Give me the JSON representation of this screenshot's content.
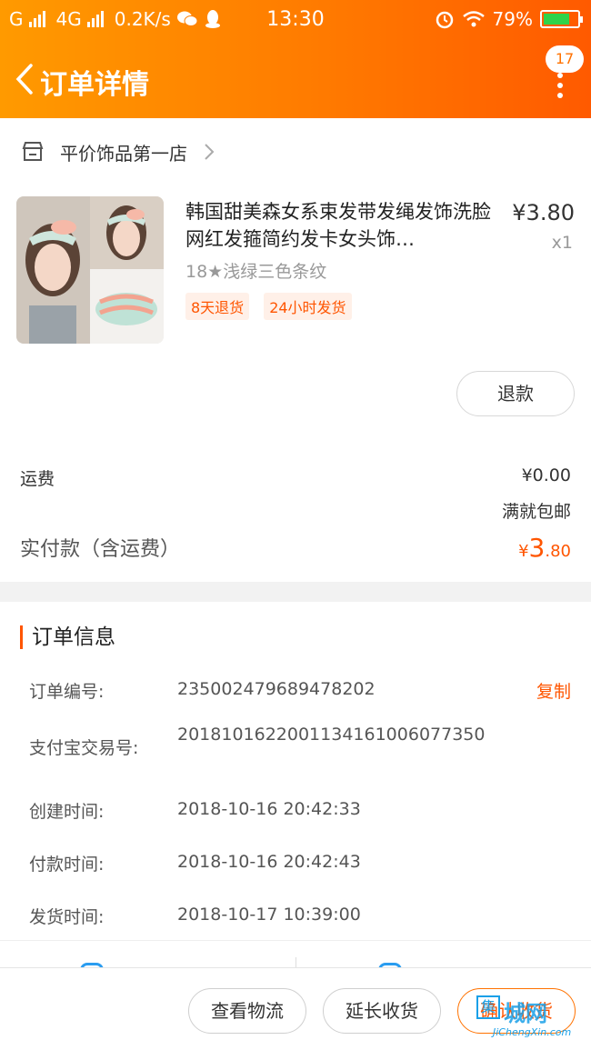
{
  "status_bar": {
    "carrier": "G",
    "network": "4G",
    "speed": "0.2K/s",
    "time": "13:30",
    "battery": "79%",
    "battery_level": 0.79
  },
  "header": {
    "title": "订单详情",
    "badge_count": "17"
  },
  "shop": {
    "name": "平价饰品第一店"
  },
  "product": {
    "title": "韩国甜美森女系束发带发绳发饰洗脸网红发箍简约发卡女头饰…",
    "sku": "18★浅绿三色条纹",
    "price": "¥3.80",
    "quantity": "x1",
    "tags": [
      "8天退货",
      "24小时发货"
    ],
    "refund_label": "退款"
  },
  "fees": {
    "shipping_label": "运费",
    "shipping_value": "¥0.00",
    "shipping_note": "满就包邮",
    "paid_label": "实付款（含运费）",
    "paid_currency": "¥",
    "paid_int": "3",
    "paid_dec": ".80"
  },
  "order_info": {
    "title": "订单信息",
    "copy_label": "复制",
    "rows": [
      {
        "label": "订单编号:",
        "value": "235002479689478202"
      },
      {
        "label": "支付宝交易号:",
        "value": "2018101622001134161006077350"
      },
      {
        "label": "创建时间:",
        "value": "2018-10-16 20:42:33"
      },
      {
        "label": "付款时间:",
        "value": "2018-10-16 20:42:43"
      },
      {
        "label": "发货时间:",
        "value": "2018-10-17 10:39:00"
      }
    ]
  },
  "actions": {
    "logistics": "查看物流",
    "extend": "延长收货",
    "confirm": "确认收货"
  },
  "watermark": {
    "logo": "集",
    "name": "城网",
    "url": "JiChengXin.com"
  },
  "colors": {
    "accent": "#ff5500",
    "header_start": "#ff9a00",
    "header_end": "#ff5a00"
  }
}
